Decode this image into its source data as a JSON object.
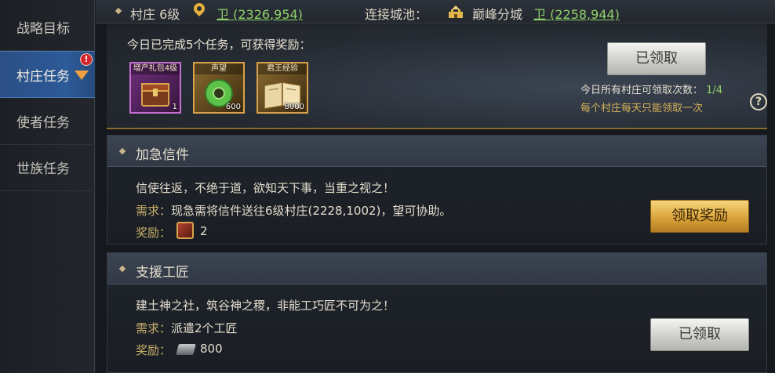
{
  "nav": {
    "items": [
      {
        "label": "战略目标"
      },
      {
        "label": "村庄任务",
        "badge": "!"
      },
      {
        "label": "使者任务"
      },
      {
        "label": "世族任务"
      }
    ]
  },
  "topbar": {
    "village": "村庄 6级",
    "village_coord": "卫 (2326,954)",
    "connect_label": "连接城池：",
    "city_name": "巅峰分城",
    "city_coord": "卫 (2258,944)"
  },
  "daily": {
    "title": "今日已完成5个任务，可获得奖励：",
    "items": [
      {
        "label": "增产礼包4级",
        "count": "1",
        "icon": "gift-chest-icon"
      },
      {
        "label": "声望",
        "count": "600",
        "icon": "jade-disc-icon"
      },
      {
        "label": "君王经验",
        "count": "8000",
        "icon": "book-icon"
      }
    ],
    "button": "已领取",
    "claims_label": "今日所有村庄可领取次数：",
    "claims_value": "1/4",
    "note": "每个村庄每天只能领取一次",
    "help": "?"
  },
  "tasks": [
    {
      "title": "加急信件",
      "desc": "信使往返，不绝于道，欲知天下事，当重之视之！",
      "req_label": "需求：",
      "req": "现急需将信件送往6级村庄(2228,1002)，望可协助。",
      "reward_label": "奖励：",
      "reward_icon": "chest-icon",
      "reward_value": "2",
      "button": "领取奖励"
    },
    {
      "title": "支援工匠",
      "desc": "建土神之社，筑谷神之稷，非能工巧匠不可为之！",
      "req_label": "需求：",
      "req": "派遣2个工匠",
      "reward_label": "奖励：",
      "reward_icon": "iron-ingot-icon",
      "reward_value": "800",
      "button": "已领取"
    }
  ],
  "colors": {
    "accent_blue": "#2d5a99",
    "coord_green": "#8fd16a",
    "gold": "#d9a33a"
  }
}
